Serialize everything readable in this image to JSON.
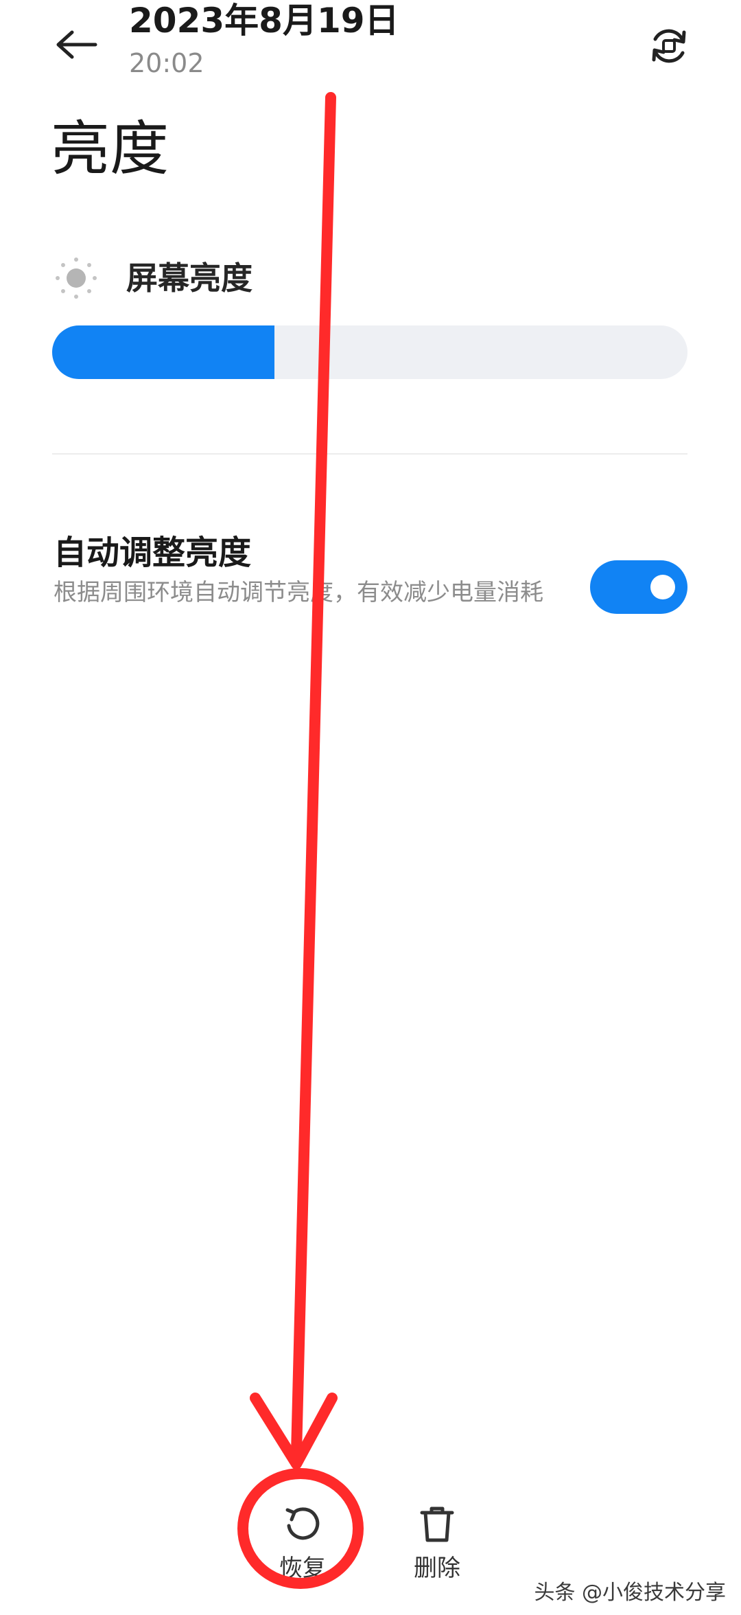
{
  "header": {
    "date": "2023年8月19日",
    "time": "20:02",
    "back_icon": "arrow-left-icon",
    "restore_icon": "restore-cycle-icon"
  },
  "page": {
    "title": "亮度"
  },
  "brightness": {
    "icon": "sun-icon",
    "label": "屏幕亮度",
    "level_percent": 35
  },
  "auto_brightness": {
    "title": "自动调整亮度",
    "description": "根据周围环境自动调节亮度，有效减少电量消耗",
    "enabled": true
  },
  "bottom_bar": {
    "restore_label": "恢复",
    "restore_icon": "undo-icon",
    "delete_label": "删除",
    "delete_icon": "trash-icon"
  },
  "colors": {
    "accent": "#1183f4",
    "annotation": "#ff2a2a",
    "track": "#eef0f4"
  },
  "watermark": {
    "text": "头条 @小俊技术分享"
  }
}
